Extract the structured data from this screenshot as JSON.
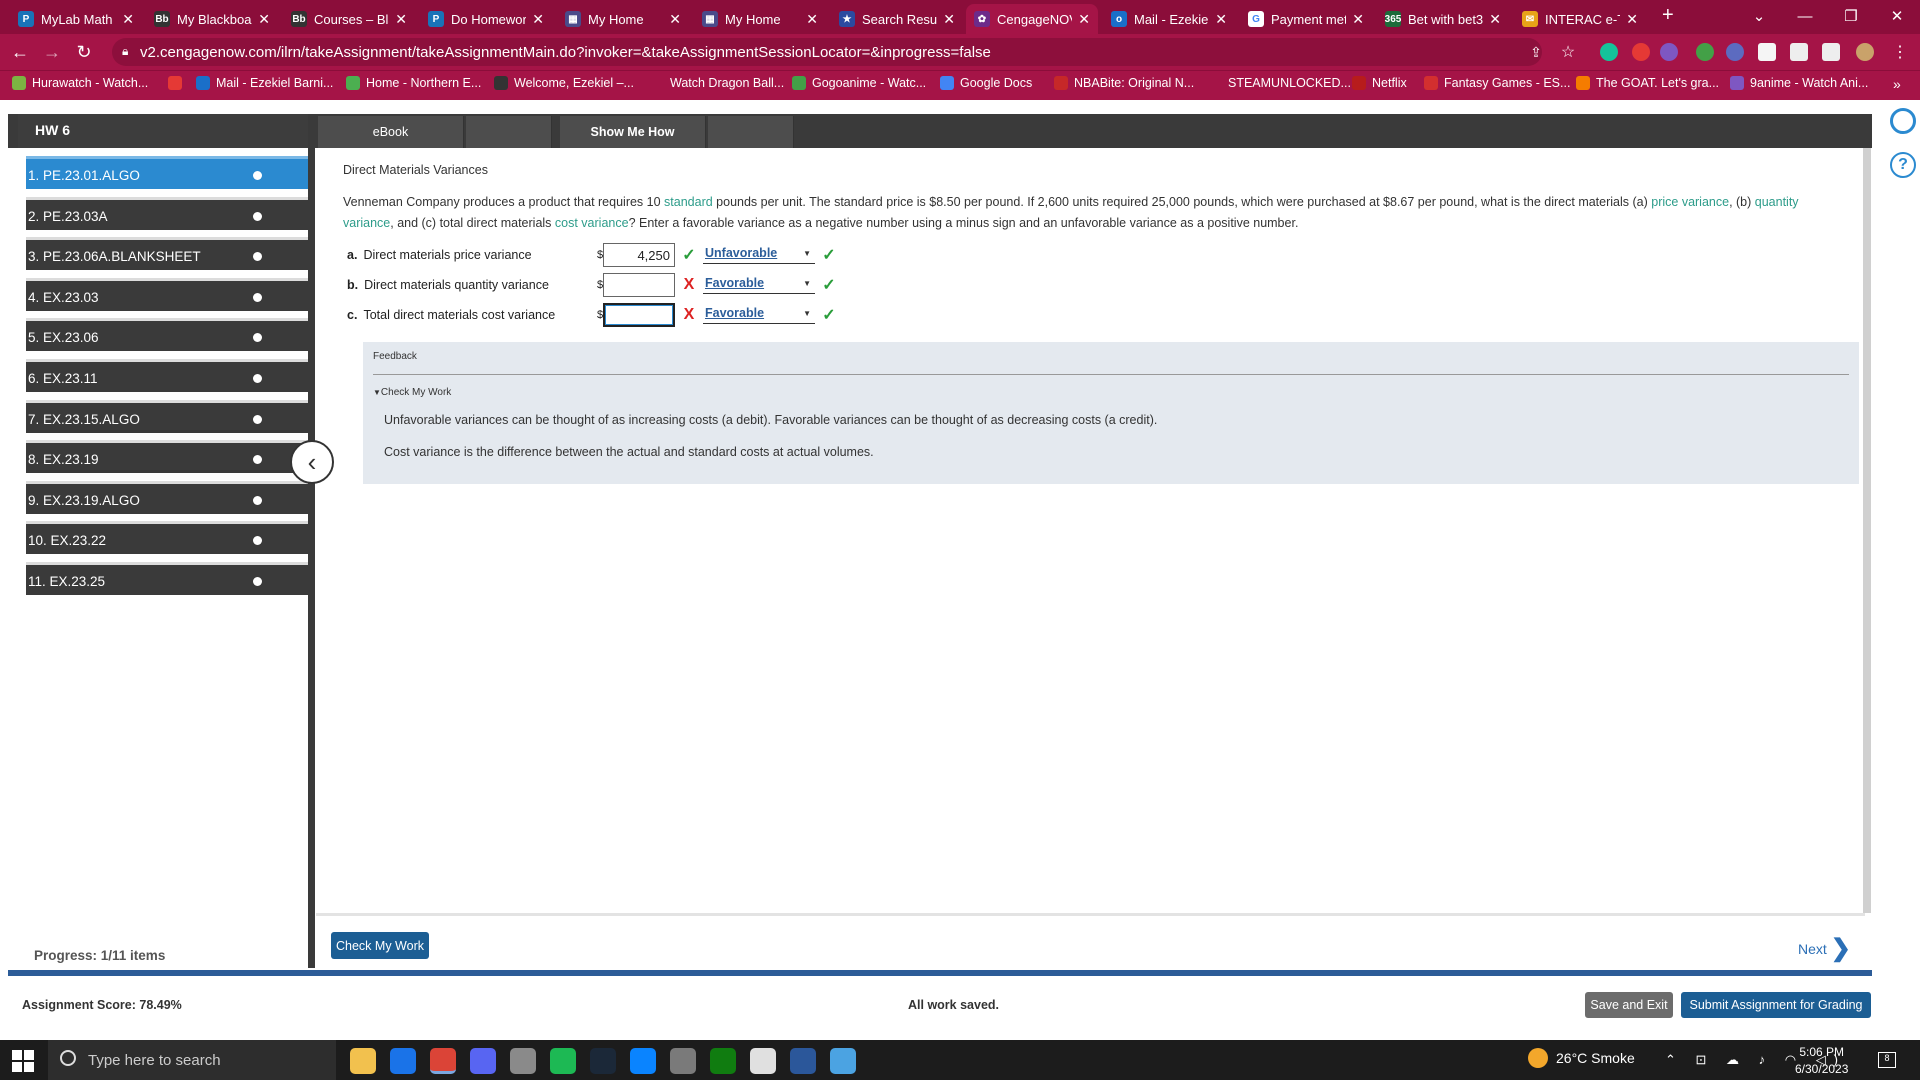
{
  "browser": {
    "tabs": [
      {
        "title": "MyLab Math",
        "fav_color": "#1a73b8",
        "fav_text": "P"
      },
      {
        "title": "My Blackboar",
        "fav_color": "#333333",
        "fav_text": "Bb"
      },
      {
        "title": "Courses – Bla",
        "fav_color": "#333333",
        "fav_text": "Bb"
      },
      {
        "title": "Do Homewor",
        "fav_color": "#1a73b8",
        "fav_text": "P"
      },
      {
        "title": "My Home",
        "fav_color": "#4a4a8a",
        "fav_text": "▦"
      },
      {
        "title": "My Home",
        "fav_color": "#4a4a8a",
        "fav_text": "▦"
      },
      {
        "title": "Search Result",
        "fav_color": "#2b4aa0",
        "fav_text": "★"
      },
      {
        "title": "CengageNOV",
        "fav_color": "#6d2b8a",
        "fav_text": "✿"
      },
      {
        "title": "Mail - Ezekiel",
        "fav_color": "#1a6fc9",
        "fav_text": "o"
      },
      {
        "title": "Payment met",
        "fav_color": "#ffffff",
        "fav_text": "G"
      },
      {
        "title": "Bet with bet3",
        "fav_color": "#1d6b3a",
        "fav_text": "365"
      },
      {
        "title": "INTERAC e-Tr",
        "fav_color": "#e8a418",
        "fav_text": "✉"
      }
    ],
    "new_tab": "+",
    "url": "v2.cengagenow.com/ilrn/takeAssignment/takeAssignmentMain.do?invoker=&takeAssignmentSessionLocator=&inprogress=false",
    "bookmarks": [
      {
        "label": "Hurawatch - Watch...",
        "color": "#7cb342"
      },
      {
        "label": "",
        "color": "#e53935"
      },
      {
        "label": "Mail - Ezekiel Barni...",
        "color": "#1a6fc9"
      },
      {
        "label": "Home - Northern E...",
        "color": "#4caf50"
      },
      {
        "label": "Welcome, Ezekiel –...",
        "color": "#333333"
      },
      {
        "label": "Watch Dragon Ball...",
        "color": "#a51447"
      },
      {
        "label": "Gogoanime - Watc...",
        "color": "#43a047"
      },
      {
        "label": "Google Docs",
        "color": "#4285f4"
      },
      {
        "label": "NBABite: Original N...",
        "color": "#c62828"
      },
      {
        "label": "STEAMUNLOCKED...",
        "color": "#a51447"
      },
      {
        "label": "Netflix",
        "color": "#b71c1c"
      },
      {
        "label": "Fantasy Games - ES...",
        "color": "#d32f2f"
      },
      {
        "label": "The GOAT. Let's gra...",
        "color": "#f57c00"
      },
      {
        "label": "9anime - Watch Ani...",
        "color": "#7e57c2"
      }
    ],
    "bookmarks_more": "»"
  },
  "assignment": {
    "title": "HW 6",
    "toolbar": {
      "ebook": "eBook",
      "show_me_how": "Show Me How"
    },
    "questions": [
      "1. PE.23.01.ALGO",
      "2. PE.23.03A",
      "3. PE.23.06A.BLANKSHEET",
      "4. EX.23.03",
      "5. EX.23.06",
      "6. EX.23.11",
      "7. EX.23.15.ALGO",
      "8. EX.23.19",
      "9. EX.23.19.ALGO",
      "10. EX.23.22",
      "11. EX.23.25"
    ],
    "progress": "Progress:  1/11 items",
    "question_title": "Direct Materials Variances",
    "question_text": {
      "p1": "Venneman Company produces a product that requires 10 ",
      "l1": "standard",
      "p2": " pounds per unit. The standard price is $8.50 per pound. If 2,600 units required 25,000 pounds, which were purchased at $8.67 per pound, what is the direct materials (a) ",
      "l2": "price variance",
      "p3": ", (b) ",
      "l3": "quantity variance",
      "p4": ", and (c) total direct materials ",
      "l4": "cost variance",
      "p5": "? Enter a favorable variance as a negative number using a minus sign and an unfavorable variance as a positive number."
    },
    "answers": [
      {
        "letter": "a.",
        "label": "Direct materials price variance",
        "currency": "$",
        "value": "4,250",
        "value_mark": "✓",
        "value_ok": true,
        "select": "Unfavorable",
        "select_mark": "✓"
      },
      {
        "letter": "b.",
        "label": "Direct materials quantity variance",
        "currency": "$",
        "value": "",
        "value_mark": "X",
        "value_ok": false,
        "select": "Favorable",
        "select_mark": "✓"
      },
      {
        "letter": "c.",
        "label": "Total direct materials cost variance",
        "currency": "$",
        "value": "",
        "value_mark": "X",
        "value_ok": false,
        "select": "Favorable",
        "select_mark": "✓"
      }
    ],
    "feedback": {
      "heading": "Feedback",
      "check_my_work": "Check My Work",
      "line1": "Unfavorable variances can be thought of as increasing costs (a debit). Favorable variances can be thought of as decreasing costs (a credit).",
      "line2": "Cost variance is the difference between the actual and standard costs at actual volumes."
    },
    "check_my_work_button": "Check My Work",
    "next": "Next",
    "score": "Assignment Score:  78.49%",
    "saved": "All work saved.",
    "save_exit": "Save and Exit",
    "submit": "Submit Assignment for Grading"
  },
  "taskbar": {
    "search_placeholder": "Type here to search",
    "weather": "26°C  Smoke",
    "time": "5:06 PM",
    "date": "6/30/2023",
    "apps": [
      {
        "name": "file-explorer-icon",
        "color": "#f2c14e"
      },
      {
        "name": "mail-icon",
        "color": "#1a73e8"
      },
      {
        "name": "chrome-icon",
        "color": "#db4437"
      },
      {
        "name": "discord-icon",
        "color": "#5865f2"
      },
      {
        "name": "app-icon",
        "color": "#8a8a8a"
      },
      {
        "name": "spotify-icon",
        "color": "#1db954"
      },
      {
        "name": "steam-icon",
        "color": "#1b2838"
      },
      {
        "name": "edge-icon",
        "color": "#0a84ff"
      },
      {
        "name": "gamepad-icon",
        "color": "#7a7a7a"
      },
      {
        "name": "xbox-icon",
        "color": "#107c10"
      },
      {
        "name": "ubisoft-icon",
        "color": "#e0e0e0"
      },
      {
        "name": "word-icon",
        "color": "#2b579a"
      },
      {
        "name": "photos-icon",
        "color": "#4ba3e2"
      }
    ]
  }
}
